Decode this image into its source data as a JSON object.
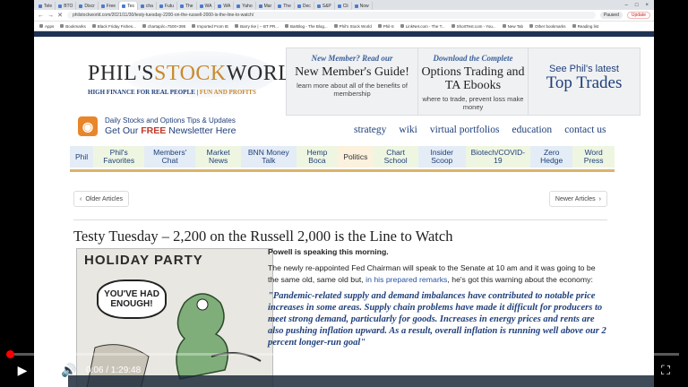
{
  "browser": {
    "tabs": [
      {
        "label": "Tele"
      },
      {
        "label": "BTO"
      },
      {
        "label": "Discr"
      },
      {
        "label": "Free"
      },
      {
        "label": "Tes"
      },
      {
        "label": "cha"
      },
      {
        "label": "Futu"
      },
      {
        "label": "The"
      },
      {
        "label": "WA"
      },
      {
        "label": "WA"
      },
      {
        "label": "Yaho"
      },
      {
        "label": "Mar"
      },
      {
        "label": "The"
      },
      {
        "label": "Dec"
      },
      {
        "label": "S&P"
      },
      {
        "label": "Cli"
      },
      {
        "label": "Now"
      }
    ],
    "url": "philstockworld.com/2021/11/30/testy-tuesday-2200-on-the-russell-2000-is-the-line-to-watch/",
    "profile_label": "Paused",
    "update_label": "Update",
    "bookmarks": [
      "Apps",
      "Bookmarks",
      "Black Friday Fishes...",
      "chartapi/c=7500+395",
      "Imported From IE",
      "Barry Ike | -- BT PR...",
      "BarBlog - The Blog...",
      "Phil's Stock World",
      "Phil-S",
      "LinkNet.com - The T...",
      "ShortTest.com - You...",
      "New Tab",
      "Other bookmarks",
      "Reading list"
    ]
  },
  "site": {
    "logo_main_a": "PHIL'S",
    "logo_main_b": "STOCK",
    "logo_main_c": "WORLD",
    "logo_tag_a": "HIGH FINANCE FOR REAL PEOPLE",
    "logo_tag_b": "FUN AND PROFITS",
    "promos": [
      {
        "sub": "New Member? Read our",
        "big": "New Member's Guide!",
        "small": "learn more about all of the benefits of membership"
      },
      {
        "sub": "Download the Complete",
        "big": "Options Trading and TA Ebooks",
        "small": "where to trade, prevent loss make money"
      },
      {
        "sub": "See Phil's latest",
        "big": "Top Trades",
        "small": ""
      }
    ],
    "rss_line1": "Daily Stocks and Options Tips & Updates",
    "rss_line2_a": "Get Our ",
    "rss_line2_free": "FREE",
    "rss_line2_b": " Newsletter Here",
    "top_links": [
      "strategy",
      "wiki",
      "virtual portfolios",
      "education",
      "contact us"
    ],
    "menu": [
      "Phil",
      "Phil's Favorites",
      "Members' Chat",
      "Market News",
      "BNN Money Talk",
      "Hemp Boca",
      "Politics",
      "Chart School",
      "Insider Scoop",
      "Biotech/COVID-19",
      "Zero Hedge",
      "Word Press"
    ],
    "older_label": "Older Articles",
    "newer_label": "Newer Articles"
  },
  "article": {
    "title": "Testy Tuesday – 2,200 on the Russell 2,000 is the Line to Watch",
    "cartoon_title": "HOLIDAY PARTY",
    "cartoon_bubble": "YOU'VE HAD ENOUGH!",
    "p1": "Powell is speaking this morning.",
    "p2_a": "The newly re-appointed Fed Chairman will speak to the Senate at 10 am and it was going to be the same old, same old but, ",
    "p2_link": "in his prepared remarks",
    "p2_b": ", he's got this warning about the economy:",
    "quote": "\"Pandemic-related supply and demand imbalances have contributed to notable price increases in some areas. Supply chain problems have made it difficult for producers to meet strong demand, particularly for goods. Increases in energy prices and rents are also pushing inflation upward. As a result, overall inflation is running well above our 2 percent longer-run goal\""
  },
  "player": {
    "time": "0:06 / 1:29:48",
    "progress_fraction": 0.0011
  }
}
